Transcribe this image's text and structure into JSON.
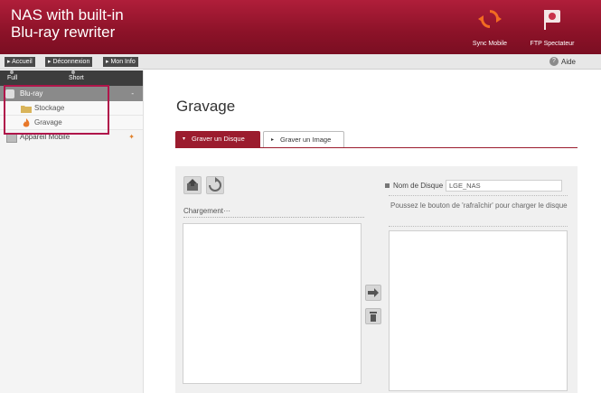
{
  "header": {
    "title_line1": "NAS with built-in",
    "title_line2": "Blu-ray rewriter",
    "sync_label": "Sync Mobile",
    "ftp_label": "FTP Spectateur"
  },
  "navbar": {
    "links": [
      "Accueil",
      "Déconnexion",
      "Mon Info"
    ],
    "help": "Aide"
  },
  "sidebar": {
    "full_menu": "Full Menu",
    "short_menu": "Short Menu",
    "section_bluray": "Blu-ray",
    "items": [
      {
        "label": "Stockage",
        "icon": "folder-icon"
      },
      {
        "label": "Gravage",
        "icon": "flame-icon"
      }
    ],
    "section_mobile": "Appareil Mobile",
    "minus": "-",
    "star": "✦"
  },
  "main": {
    "title": "Gravage",
    "tabs": [
      {
        "label": "Graver un Disque",
        "active": true
      },
      {
        "label": "Graver un Image",
        "active": false
      }
    ],
    "charge_label": "Chargement···",
    "disk_name_label": "Nom de Disque",
    "disk_name_value": "LGE_NAS",
    "hint": "Poussez le bouton de 'rafraîchir' pour charger le disque"
  },
  "colors": {
    "header": "#8c1228",
    "accent": "#9b1c2e",
    "highlight": "#b0154a"
  }
}
